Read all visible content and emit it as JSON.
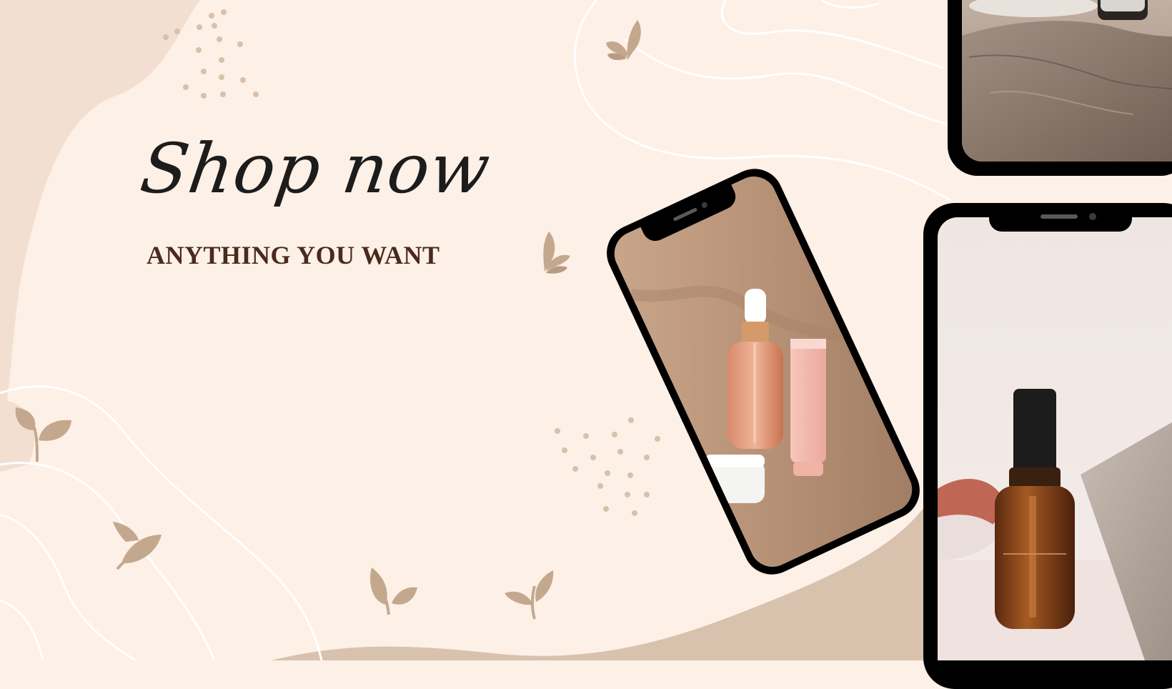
{
  "headline": "Shop now",
  "subheadline": "ANYTHING YOU WANT",
  "colors": {
    "background": "#fdf0e6",
    "blob": "#f2dfd1",
    "bottom_wave": "#d8c2ae",
    "accent": "#c3a88e",
    "headline_text": "#1c1c1c",
    "subheadline_text": "#4a2a1e",
    "phone_frame": "#000000"
  },
  "decorations": {
    "butterflies": [
      "butterfly-icon",
      "butterfly-icon"
    ],
    "leaves": [
      "leaf-icon",
      "leaf-icon",
      "leaf-icon",
      "leaf-icon"
    ],
    "dot_clusters": 2
  },
  "phones": [
    {
      "name": "phone-top-right",
      "content": "product-photo-stone"
    },
    {
      "name": "phone-tilted",
      "content": "product-photo-serum-bottle"
    },
    {
      "name": "phone-right",
      "content": "product-photo-amber-bottle"
    }
  ]
}
